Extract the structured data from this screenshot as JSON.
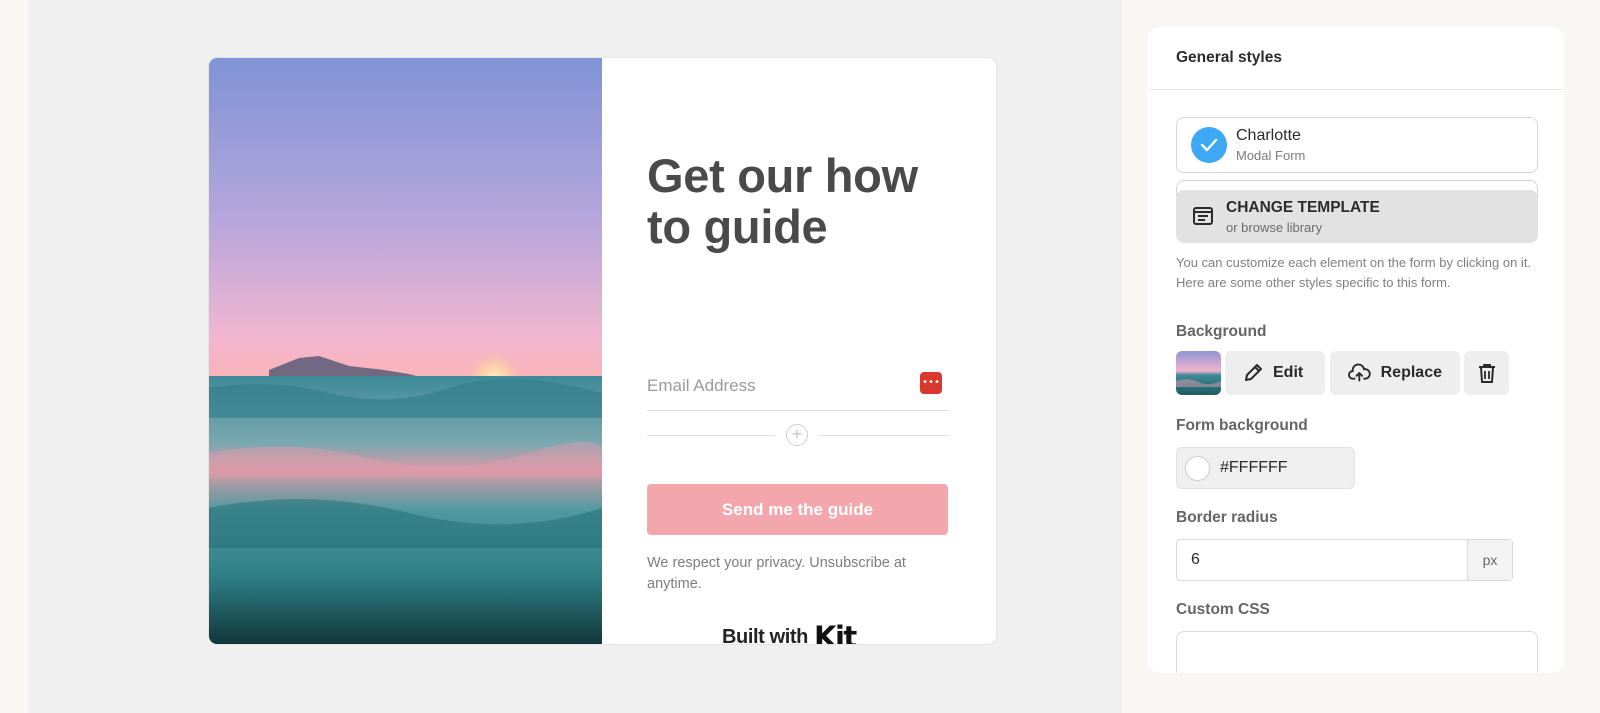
{
  "form": {
    "headline": "Get our how to guide",
    "email_placeholder": "Email Address",
    "submit_label": "Send me the guide",
    "privacy_text": "We respect your privacy. Unsubscribe at anytime.",
    "built_with": "Built with",
    "brand": "Kit",
    "accent_color": "#f4a6ad"
  },
  "panel": {
    "title": "General styles",
    "template": {
      "name": "Charlotte",
      "type": "Modal Form"
    },
    "change_template": {
      "title": "CHANGE TEMPLATE",
      "subtitle": "or browse library"
    },
    "help_text": "You can customize each element on the form by clicking on it. Here are some other styles specific to this form.",
    "background": {
      "label": "Background",
      "edit_label": "Edit",
      "replace_label": "Replace"
    },
    "form_background": {
      "label": "Form background",
      "value": "#FFFFFF"
    },
    "border_radius": {
      "label": "Border radius",
      "value": "6",
      "unit": "px"
    },
    "custom_css": {
      "label": "Custom CSS",
      "value": ""
    }
  },
  "icons": [
    "check-icon",
    "template-icon",
    "pencil-icon",
    "upload-cloud-icon",
    "trash-icon",
    "plus-circle-icon",
    "password-manager-icon"
  ]
}
